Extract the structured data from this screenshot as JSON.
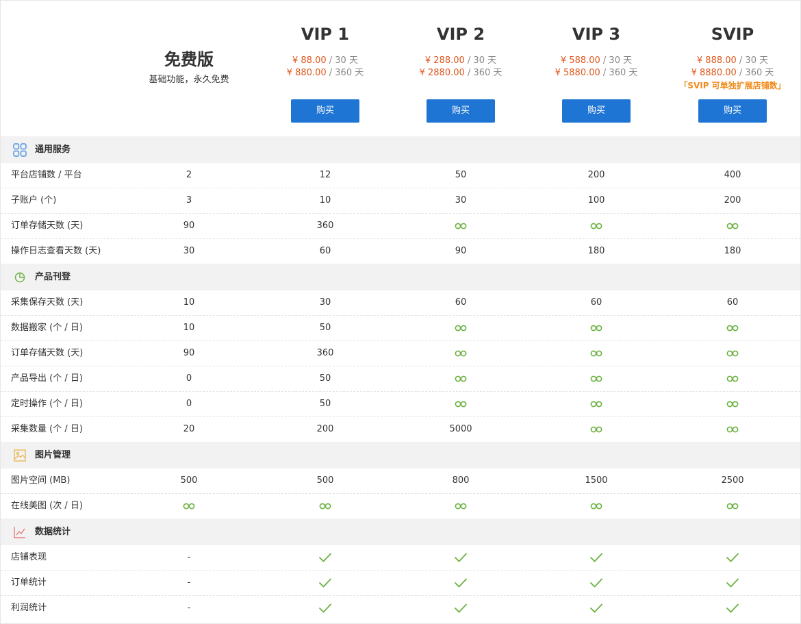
{
  "plans": [
    {
      "name": "免费版",
      "desc": "基础功能，永久免费"
    },
    {
      "name": "VIP 1",
      "prices": [
        {
          "amount": "¥ 88.00",
          "period": " / 30 天"
        },
        {
          "amount": "¥ 880.00",
          "period": " / 360 天"
        }
      ],
      "buy_label": "购买"
    },
    {
      "name": "VIP 2",
      "prices": [
        {
          "amount": "¥ 288.00",
          "period": " / 30 天"
        },
        {
          "amount": "¥ 2880.00",
          "period": " / 360 天"
        }
      ],
      "buy_label": "购买"
    },
    {
      "name": "VIP 3",
      "prices": [
        {
          "amount": "¥ 588.00",
          "period": " / 30 天"
        },
        {
          "amount": "¥ 5880.00",
          "period": " / 360 天"
        }
      ],
      "buy_label": "购买"
    },
    {
      "name": "SVIP",
      "prices": [
        {
          "amount": "¥ 888.00",
          "period": " / 30 天"
        },
        {
          "amount": "¥ 8880.00",
          "period": " / 360 天"
        }
      ],
      "note": "「SVIP 可单独扩展店铺数」",
      "buy_label": "购买"
    }
  ],
  "colors": {
    "price": "#e0571d",
    "button": "#1f75d3",
    "infinity": "#6ab13f",
    "check": "#6ab13f",
    "note": "#f08a18"
  },
  "sections": [
    {
      "title": "通用服务",
      "icon": "grid-icon",
      "rows": [
        {
          "label": "平台店铺数 / 平台",
          "values": [
            "2",
            "12",
            "50",
            "200",
            "400"
          ]
        },
        {
          "label": "子账户 (个)",
          "values": [
            "3",
            "10",
            "30",
            "100",
            "200"
          ]
        },
        {
          "label": "订单存储天数 (天)",
          "values": [
            "90",
            "360",
            "∞",
            "∞",
            "∞"
          ]
        },
        {
          "label": "操作日志查看天数 (天)",
          "values": [
            "30",
            "60",
            "90",
            "180",
            "180"
          ]
        }
      ]
    },
    {
      "title": "产品刊登",
      "icon": "pie-chart-icon",
      "rows": [
        {
          "label": "采集保存天数 (天)",
          "values": [
            "10",
            "30",
            "60",
            "60",
            "60"
          ]
        },
        {
          "label": "数据搬家 (个 / 日)",
          "values": [
            "10",
            "50",
            "∞",
            "∞",
            "∞"
          ]
        },
        {
          "label": "订单存储天数 (天)",
          "values": [
            "90",
            "360",
            "∞",
            "∞",
            "∞"
          ]
        },
        {
          "label": "产品导出 (个 / 日)",
          "values": [
            "0",
            "50",
            "∞",
            "∞",
            "∞"
          ]
        },
        {
          "label": "定时操作 (个 / 日)",
          "values": [
            "0",
            "50",
            "∞",
            "∞",
            "∞"
          ]
        },
        {
          "label": "采集数量 (个 / 日)",
          "values": [
            "20",
            "200",
            "5000",
            "∞",
            "∞"
          ]
        }
      ]
    },
    {
      "title": "图片管理",
      "icon": "image-icon",
      "rows": [
        {
          "label": "图片空间 (MB)",
          "values": [
            "500",
            "500",
            "800",
            "1500",
            "2500"
          ]
        },
        {
          "label": "在线美图 (次 / 日)",
          "values": [
            "∞",
            "∞",
            "∞",
            "∞",
            "∞"
          ]
        }
      ]
    },
    {
      "title": "数据统计",
      "icon": "line-chart-icon",
      "rows": [
        {
          "label": "店铺表现",
          "values": [
            "-",
            "✓",
            "✓",
            "✓",
            "✓"
          ]
        },
        {
          "label": "订单统计",
          "values": [
            "-",
            "✓",
            "✓",
            "✓",
            "✓"
          ]
        },
        {
          "label": "利润统计",
          "values": [
            "-",
            "✓",
            "✓",
            "✓",
            "✓"
          ]
        }
      ]
    }
  ]
}
